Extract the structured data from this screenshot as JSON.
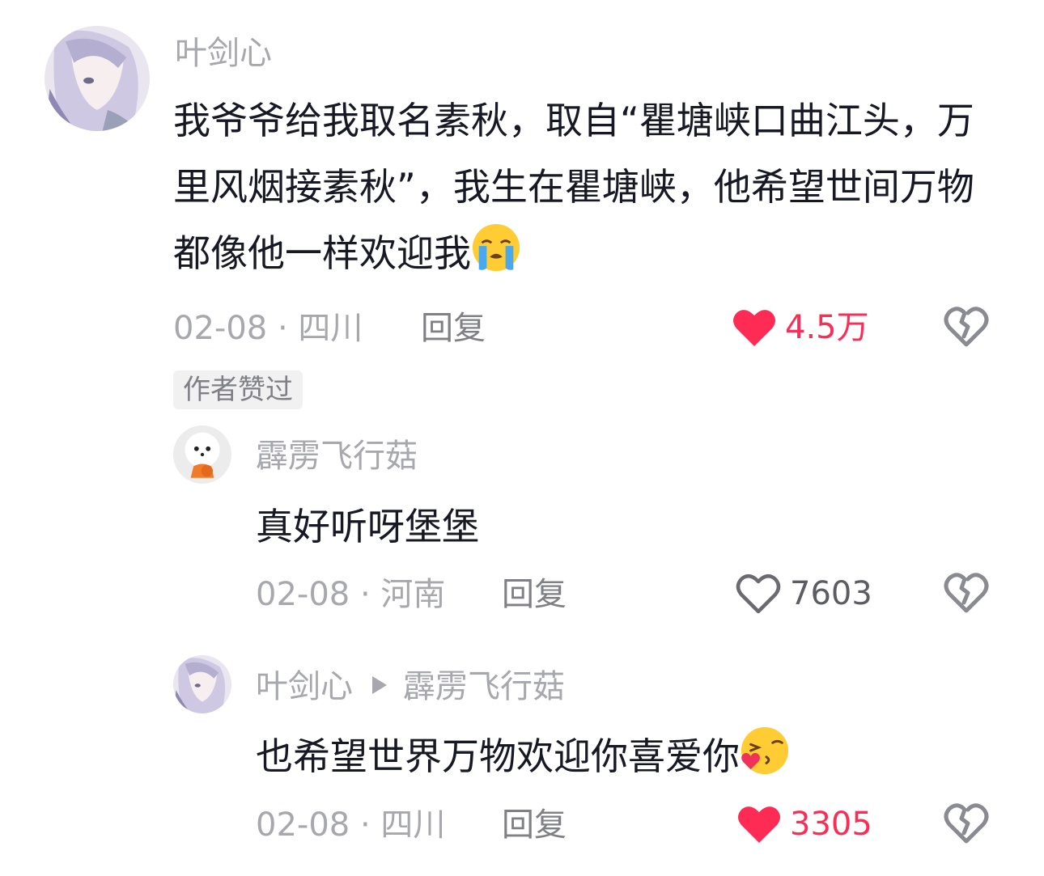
{
  "comments": [
    {
      "author": "叶剑心",
      "text": "我爷爷给我取名素秋，取自“瞿塘峡口曲江头，万里风烟接素秋”，我生在瞿塘峡，他希望世间万物都像他一样欢迎我",
      "emoji": "loudly-crying-face",
      "date_location": "02-08 · 四川",
      "reply_label": "回复",
      "likes": "4.5万",
      "liked": true,
      "tag": "作者赞过"
    },
    {
      "author": "霹雳飞行菇",
      "text": "真好听呀堡堡",
      "date_location": "02-08 · 河南",
      "reply_label": "回复",
      "likes": "7603",
      "liked": false
    },
    {
      "author": "叶剑心",
      "reply_to": "霹雳飞行菇",
      "text": "也希望世界万物欢迎你喜爱你",
      "emoji": "face-blowing-a-kiss",
      "date_location": "02-08 · 四川",
      "reply_label": "回复",
      "likes": "3305",
      "liked": true
    }
  ],
  "colors": {
    "like_red": "#fe2c55",
    "meta_gray": "#a7a8ad",
    "text_dark": "#161823"
  }
}
